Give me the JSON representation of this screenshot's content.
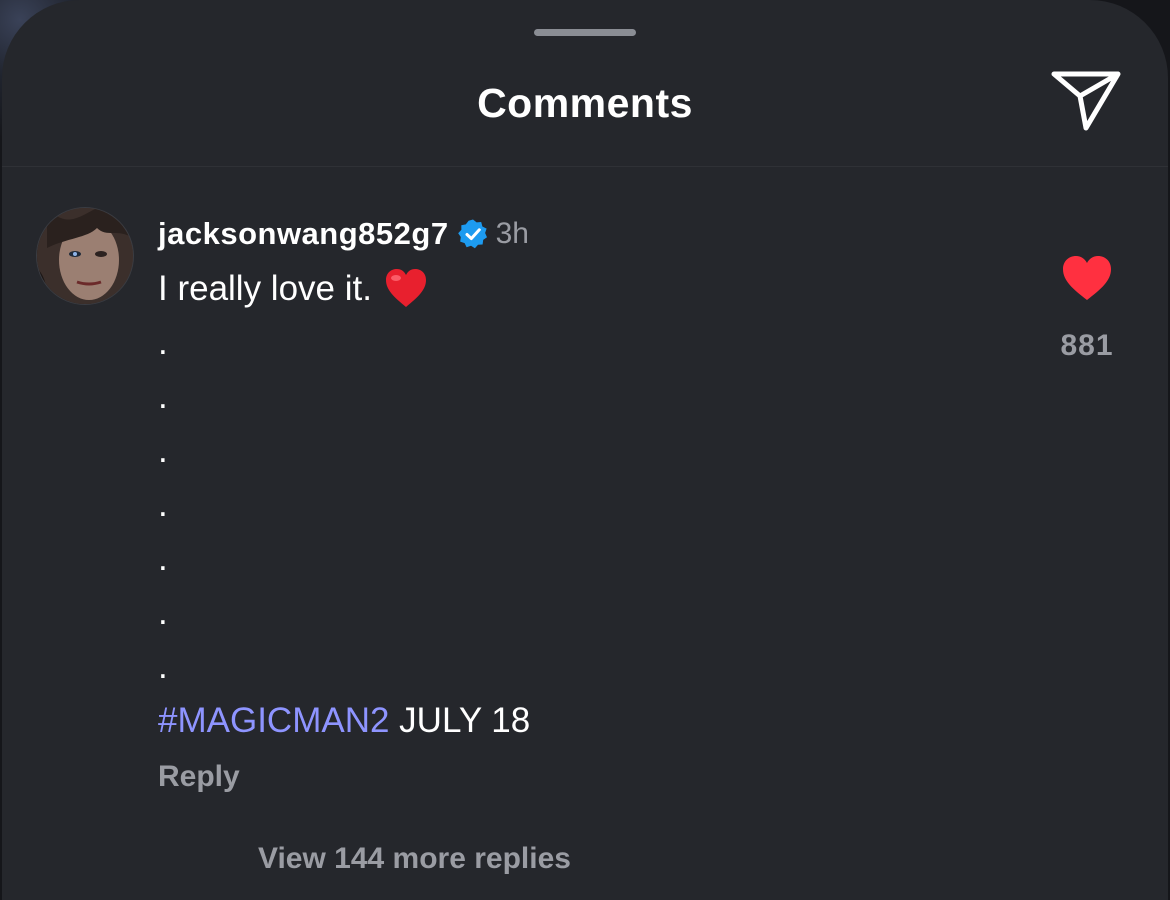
{
  "header": {
    "title": "Comments",
    "share_icon": "paper-plane-icon"
  },
  "comment": {
    "username": "jacksonwang852g7",
    "verified_icon": "verified-badge-icon",
    "time": "3h",
    "text_first_line": "I really love it.",
    "emoji": "red-heart-emoji",
    "dots": [
      ".",
      ".",
      ".",
      ".",
      ".",
      ".",
      "."
    ],
    "hashtag": "#MAGICMAN2",
    "after_hashtag": "JULY 18",
    "reply_label": "Reply",
    "like_icon": "filled-heart-icon",
    "like_count": "881",
    "view_replies_label": "View 144 more replies"
  },
  "colors": {
    "sheet_background": "#25272c",
    "accent_hashtag": "#8e94ff",
    "like_heart": "#ff3040",
    "verified_blue": "#1d9bf0",
    "muted_text": "#9a9ca3"
  }
}
